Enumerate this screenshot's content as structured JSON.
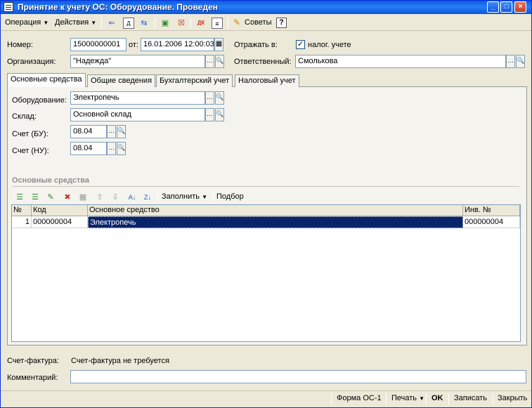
{
  "window": {
    "title": "Принятие к учету ОС: Оборудование. Проведен",
    "controls": {
      "minimize": "_",
      "maximize": "□",
      "close": "×"
    }
  },
  "toolbar": {
    "operation_label": "Операция",
    "actions_label": "Действия",
    "tips_label": "Советы",
    "help_label": "?"
  },
  "header": {
    "number_label": "Номер:",
    "number_value": "15000000001",
    "date_label": "от:",
    "date_value": "16.01.2006 12:00:03",
    "reflect_label": "Отражать в:",
    "tax_checkbox_label": "налог. учете",
    "tax_checked": true,
    "org_label": "Организация:",
    "org_value": "\"Надежда\"",
    "responsible_label": "Ответственный:",
    "responsible_value": "Смолькова"
  },
  "tabs": [
    {
      "label": "Основные средства",
      "active": true
    },
    {
      "label": "Общие сведения",
      "active": false
    },
    {
      "label": "Бухгалтерский учет",
      "active": false
    },
    {
      "label": "Налоговый учет",
      "active": false
    }
  ],
  "form": {
    "equipment_label": "Оборудование:",
    "equipment_value": "Электропечь",
    "warehouse_label": "Склад:",
    "warehouse_value": "Основной склад",
    "account_bu_label": "Счет (БУ):",
    "account_bu_value": "08.04",
    "account_nu_label": "Счет (НУ):",
    "account_nu_value": "08.04"
  },
  "assets": {
    "section_title": "Основные средства",
    "fill_label": "Заполнить",
    "select_label": "Подбор",
    "columns": [
      "№",
      "Код",
      "Основное средство",
      "Инв. №"
    ],
    "rows": [
      {
        "n": "1",
        "code": "000000004",
        "name": "Электропечь",
        "inv": "000000004"
      }
    ]
  },
  "footer": {
    "invoice_label": "Счет-фактура:",
    "invoice_value": "Счет-фактура не требуется",
    "comment_label": "Комментарий:",
    "comment_value": ""
  },
  "statusbar": {
    "form_label": "Форма ОС-1",
    "print_label": "Печать",
    "ok_label": "OK",
    "save_label": "Записать",
    "close_label": "Закрыть"
  }
}
